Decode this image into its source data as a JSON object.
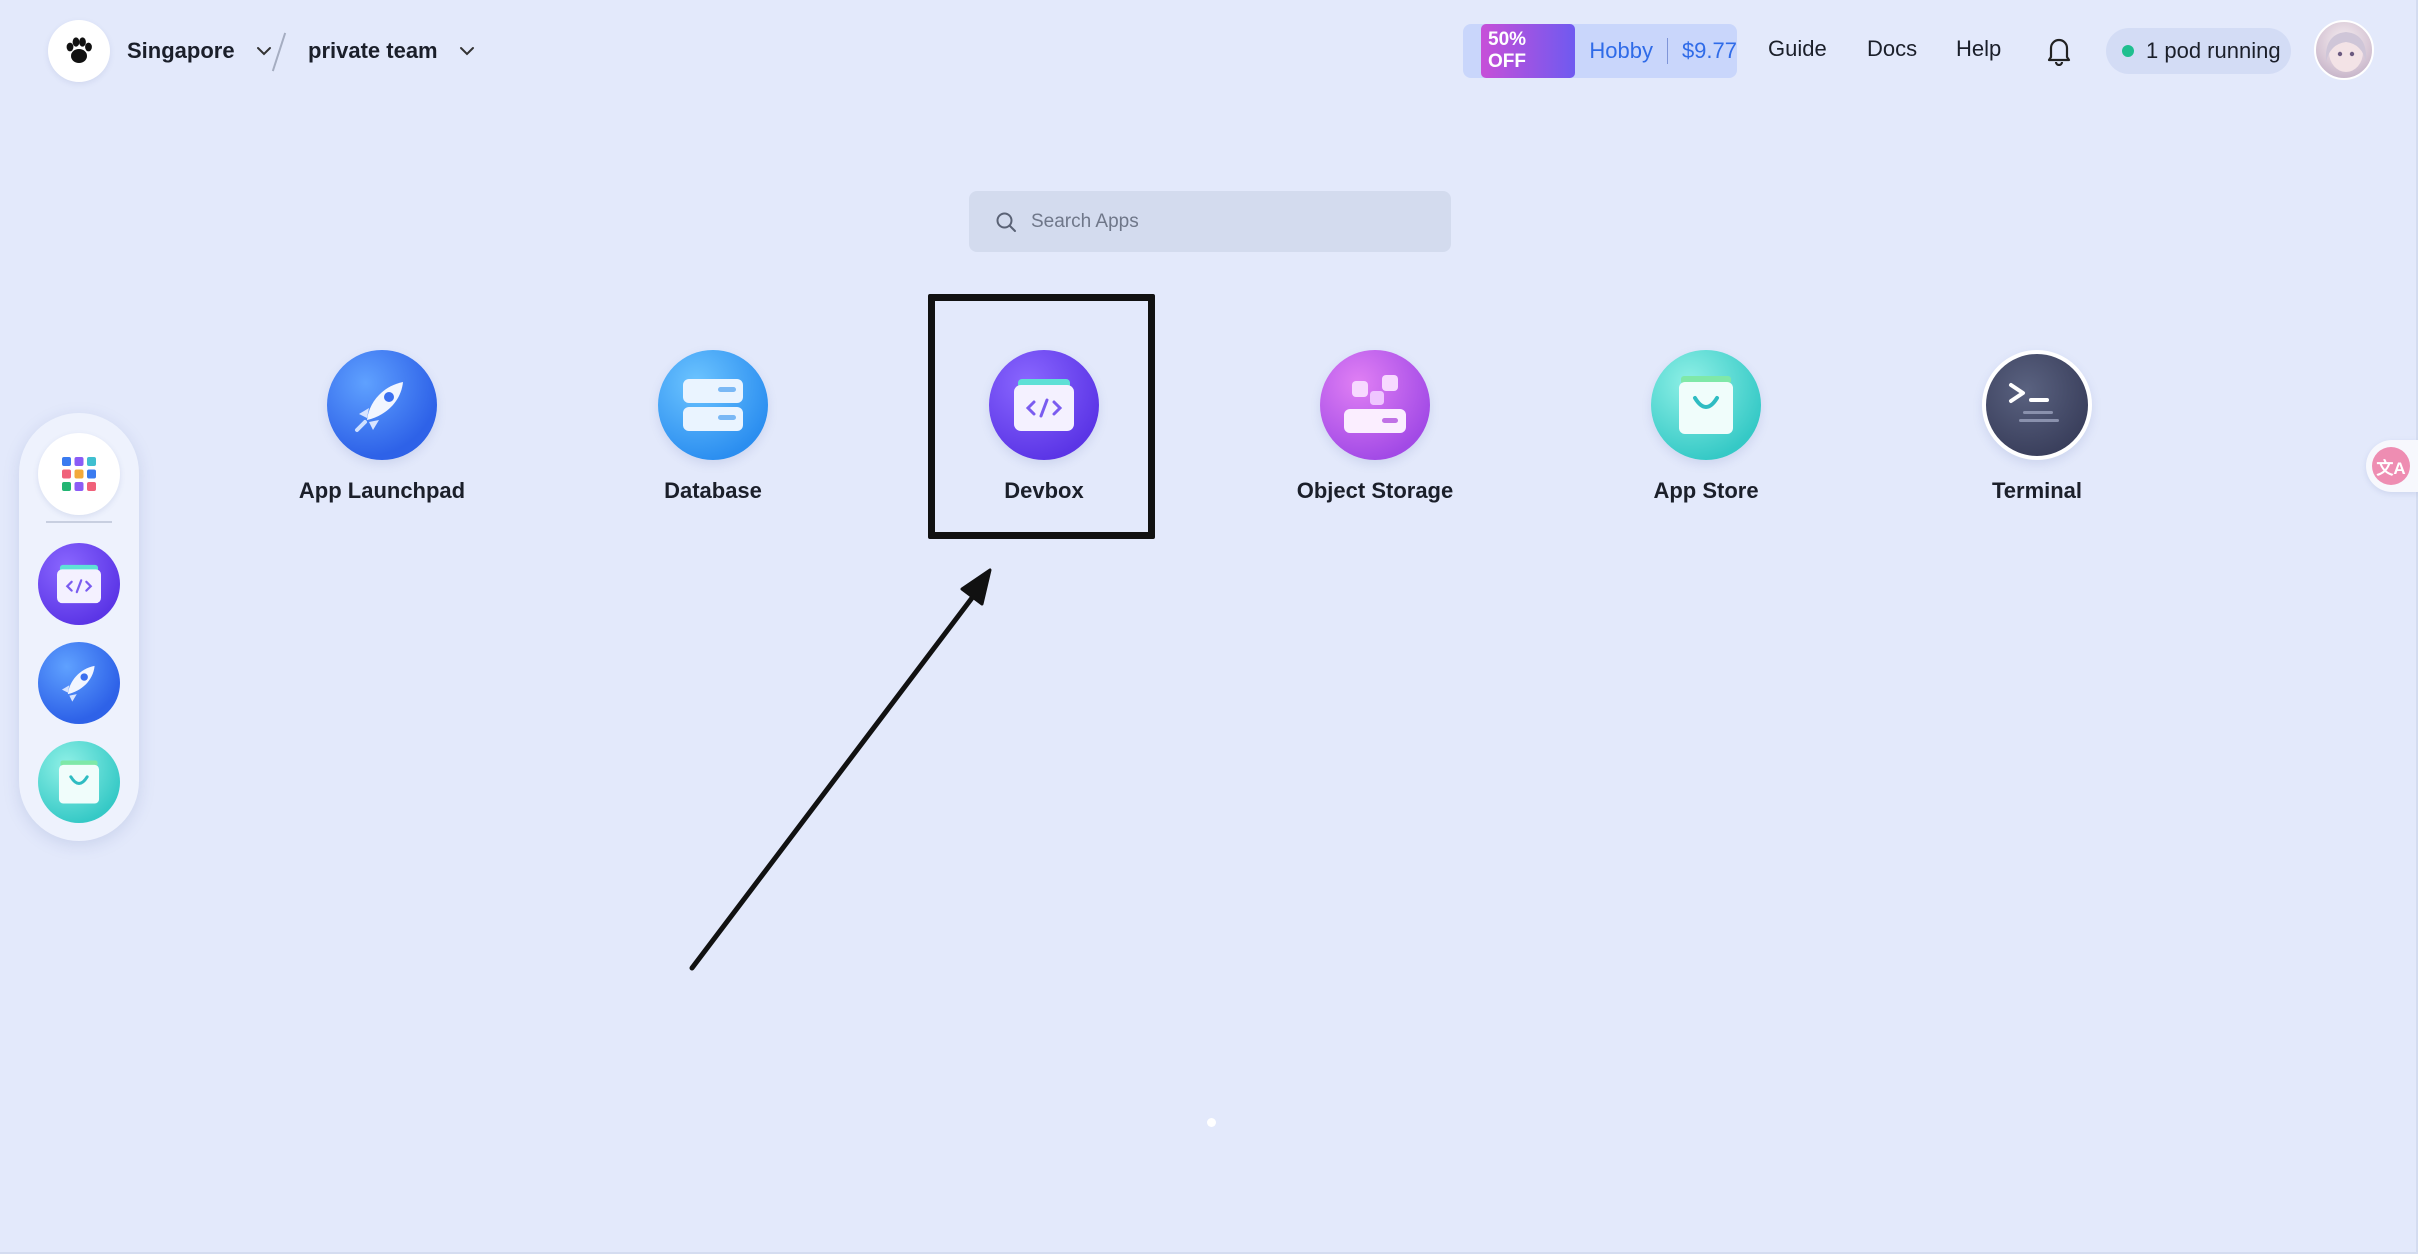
{
  "header": {
    "region": "Singapore",
    "team": "private team",
    "promo": {
      "badge": "50% OFF",
      "plan": "Hobby",
      "price": "$9.77"
    },
    "nav": {
      "guide": "Guide",
      "docs": "Docs",
      "help": "Help"
    },
    "pods_status": "1 pod running"
  },
  "search": {
    "placeholder": "Search Apps"
  },
  "apps": [
    {
      "label": "App Launchpad",
      "icon": "rocket-icon"
    },
    {
      "label": "Database",
      "icon": "database-icon"
    },
    {
      "label": "Devbox",
      "icon": "devbox-code-icon"
    },
    {
      "label": "Object Storage",
      "icon": "object-storage-icon"
    },
    {
      "label": "App Store",
      "icon": "shopping-bag-icon"
    },
    {
      "label": "Terminal",
      "icon": "terminal-icon"
    }
  ],
  "highlighted_app": "Devbox",
  "dock": [
    "apps-grid-icon",
    "devbox-code-icon",
    "rocket-icon",
    "shopping-bag-icon"
  ],
  "translate_glyph": "文A",
  "colors": {
    "background": "#e3e9fb",
    "status_green": "#1fbf8f",
    "promo_blue": "#2f6be8"
  }
}
